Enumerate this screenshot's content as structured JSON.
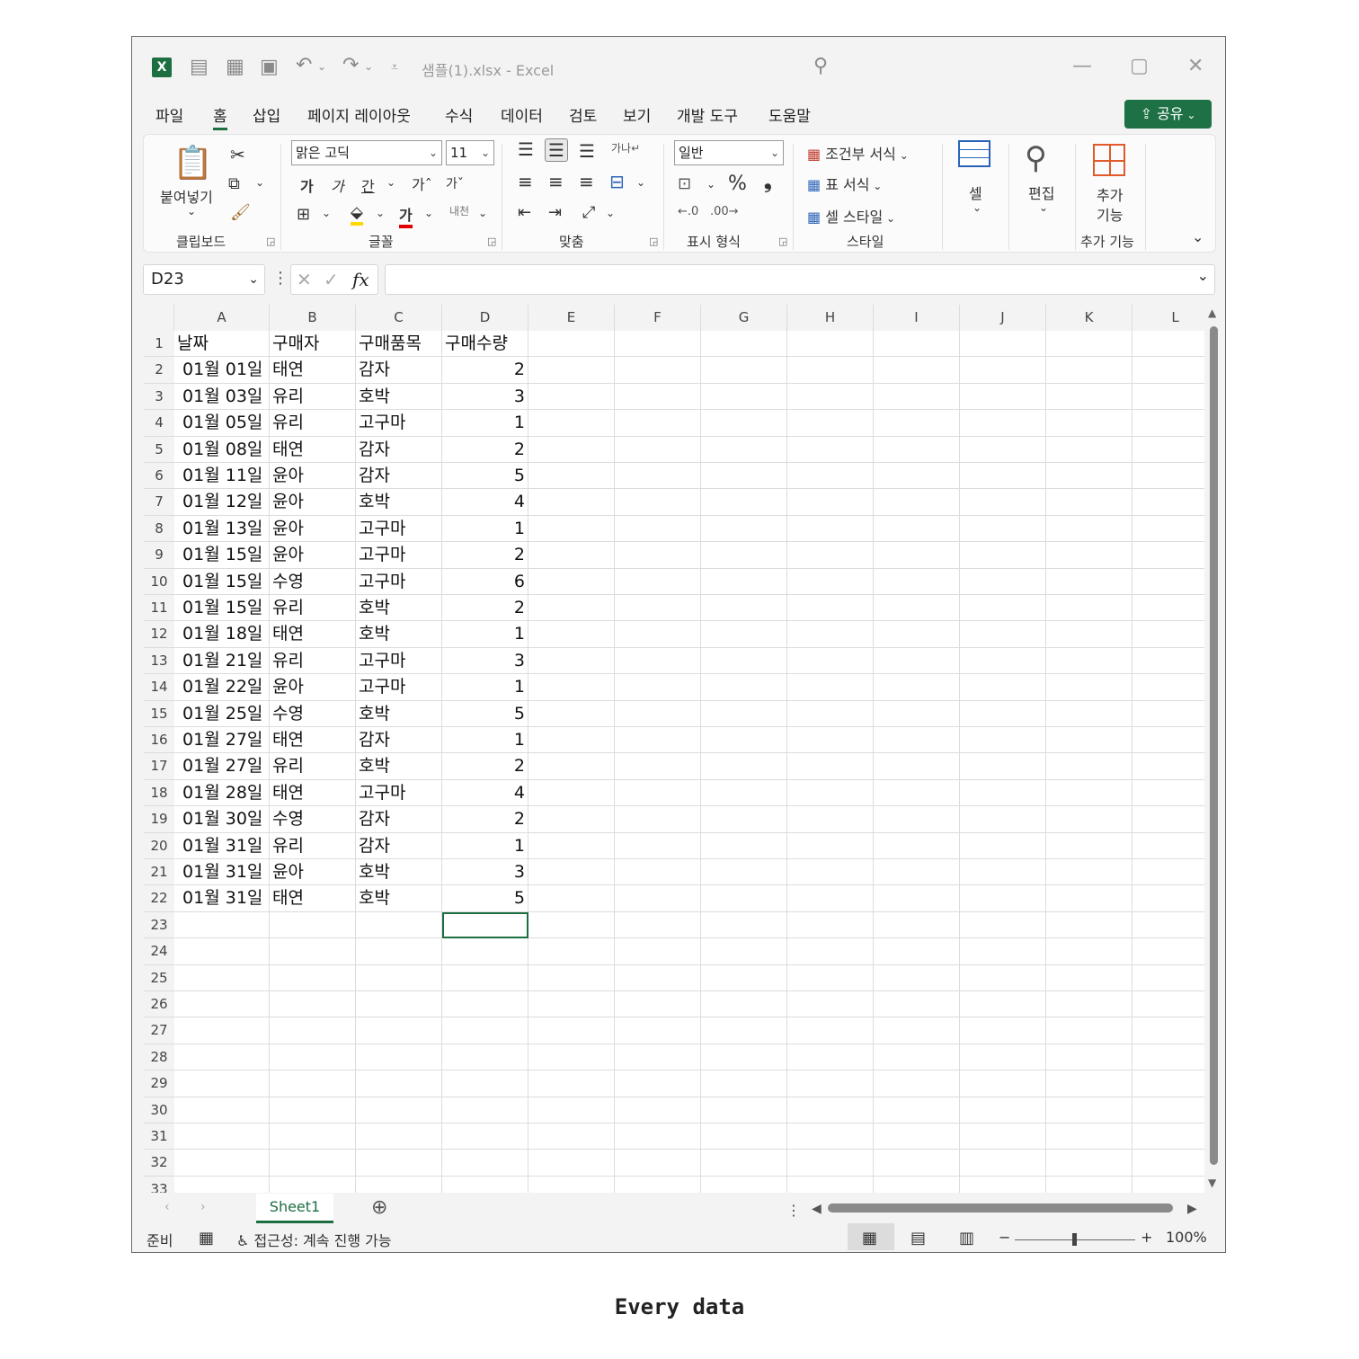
{
  "titlebar": {
    "app_icon": "excel-logo-icon",
    "app_letter": "X",
    "title": "샘플(1).xlsx  -  Excel"
  },
  "menu": {
    "items": [
      "파일",
      "홈",
      "삽입",
      "페이지 레이아웃",
      "수식",
      "데이터",
      "검토",
      "보기",
      "개발 도구",
      "도움말"
    ],
    "active": "홈",
    "share_label": "공유"
  },
  "ribbon": {
    "clipboard": {
      "paste_label": "붙여넣기",
      "group_label": "클립보드"
    },
    "font": {
      "font_name": "맑은 고딕",
      "font_size": "11",
      "bold": "가",
      "italic": "가",
      "underline": "간",
      "grow": "가ˆ",
      "shrink": "가ˇ",
      "group_label": "글꼴"
    },
    "alignment": {
      "group_label": "맞춤"
    },
    "number": {
      "format": "일반",
      "percent": "%",
      "comma": "❟",
      "group_label": "표시 형식"
    },
    "styles": {
      "conditional": "조건부 서식",
      "table": "표 서식",
      "cell_style": "셀 스타일",
      "group_label": "스타일"
    },
    "cells": {
      "label": "셀"
    },
    "editing": {
      "label": "편집"
    },
    "addins": {
      "label_line1": "추가",
      "label_line2": "기능",
      "group_label": "추가 기능"
    }
  },
  "formula_bar": {
    "name_box": "D23",
    "fx": "fx",
    "value": ""
  },
  "columns": [
    "A",
    "B",
    "C",
    "D",
    "E",
    "F",
    "G",
    "H",
    "I",
    "J",
    "K",
    "L"
  ],
  "row_numbers": [
    "1",
    "2",
    "3",
    "4",
    "5",
    "6",
    "7",
    "8",
    "9",
    "10",
    "11",
    "12",
    "13",
    "14",
    "15",
    "16",
    "17",
    "18",
    "19",
    "20",
    "21",
    "22",
    "23",
    "24",
    "25",
    "26",
    "27",
    "28",
    "29",
    "30",
    "31",
    "32",
    "33"
  ],
  "header_row": [
    "날짜",
    "구매자",
    "구매품목",
    "구매수량"
  ],
  "rows": [
    [
      "01월 01일",
      "태연",
      "감자",
      "2"
    ],
    [
      "01월 03일",
      "유리",
      "호박",
      "3"
    ],
    [
      "01월 05일",
      "유리",
      "고구마",
      "1"
    ],
    [
      "01월 08일",
      "태연",
      "감자",
      "2"
    ],
    [
      "01월 11일",
      "윤아",
      "감자",
      "5"
    ],
    [
      "01월 12일",
      "윤아",
      "호박",
      "4"
    ],
    [
      "01월 13일",
      "윤아",
      "고구마",
      "1"
    ],
    [
      "01월 15일",
      "윤아",
      "고구마",
      "2"
    ],
    [
      "01월 15일",
      "수영",
      "고구마",
      "6"
    ],
    [
      "01월 15일",
      "유리",
      "호박",
      "2"
    ],
    [
      "01월 18일",
      "태연",
      "호박",
      "1"
    ],
    [
      "01월 21일",
      "유리",
      "고구마",
      "3"
    ],
    [
      "01월 22일",
      "윤아",
      "고구마",
      "1"
    ],
    [
      "01월 25일",
      "수영",
      "호박",
      "5"
    ],
    [
      "01월 27일",
      "태연",
      "감자",
      "1"
    ],
    [
      "01월 27일",
      "유리",
      "호박",
      "2"
    ],
    [
      "01월 28일",
      "태연",
      "고구마",
      "4"
    ],
    [
      "01월 30일",
      "수영",
      "감자",
      "2"
    ],
    [
      "01월 31일",
      "유리",
      "감자",
      "1"
    ],
    [
      "01월 31일",
      "윤아",
      "호박",
      "3"
    ],
    [
      "01월 31일",
      "태연",
      "호박",
      "5"
    ]
  ],
  "sheet_tabs": {
    "active": "Sheet1"
  },
  "status_bar": {
    "ready": "준비",
    "accessibility": "접근성: 계속 진행 가능",
    "zoom": "100%",
    "zoom_minus": "−",
    "zoom_plus": "+"
  },
  "caption": "Every data",
  "colors": {
    "accent": "#1d6f42",
    "share_bg": "#1e7145"
  }
}
